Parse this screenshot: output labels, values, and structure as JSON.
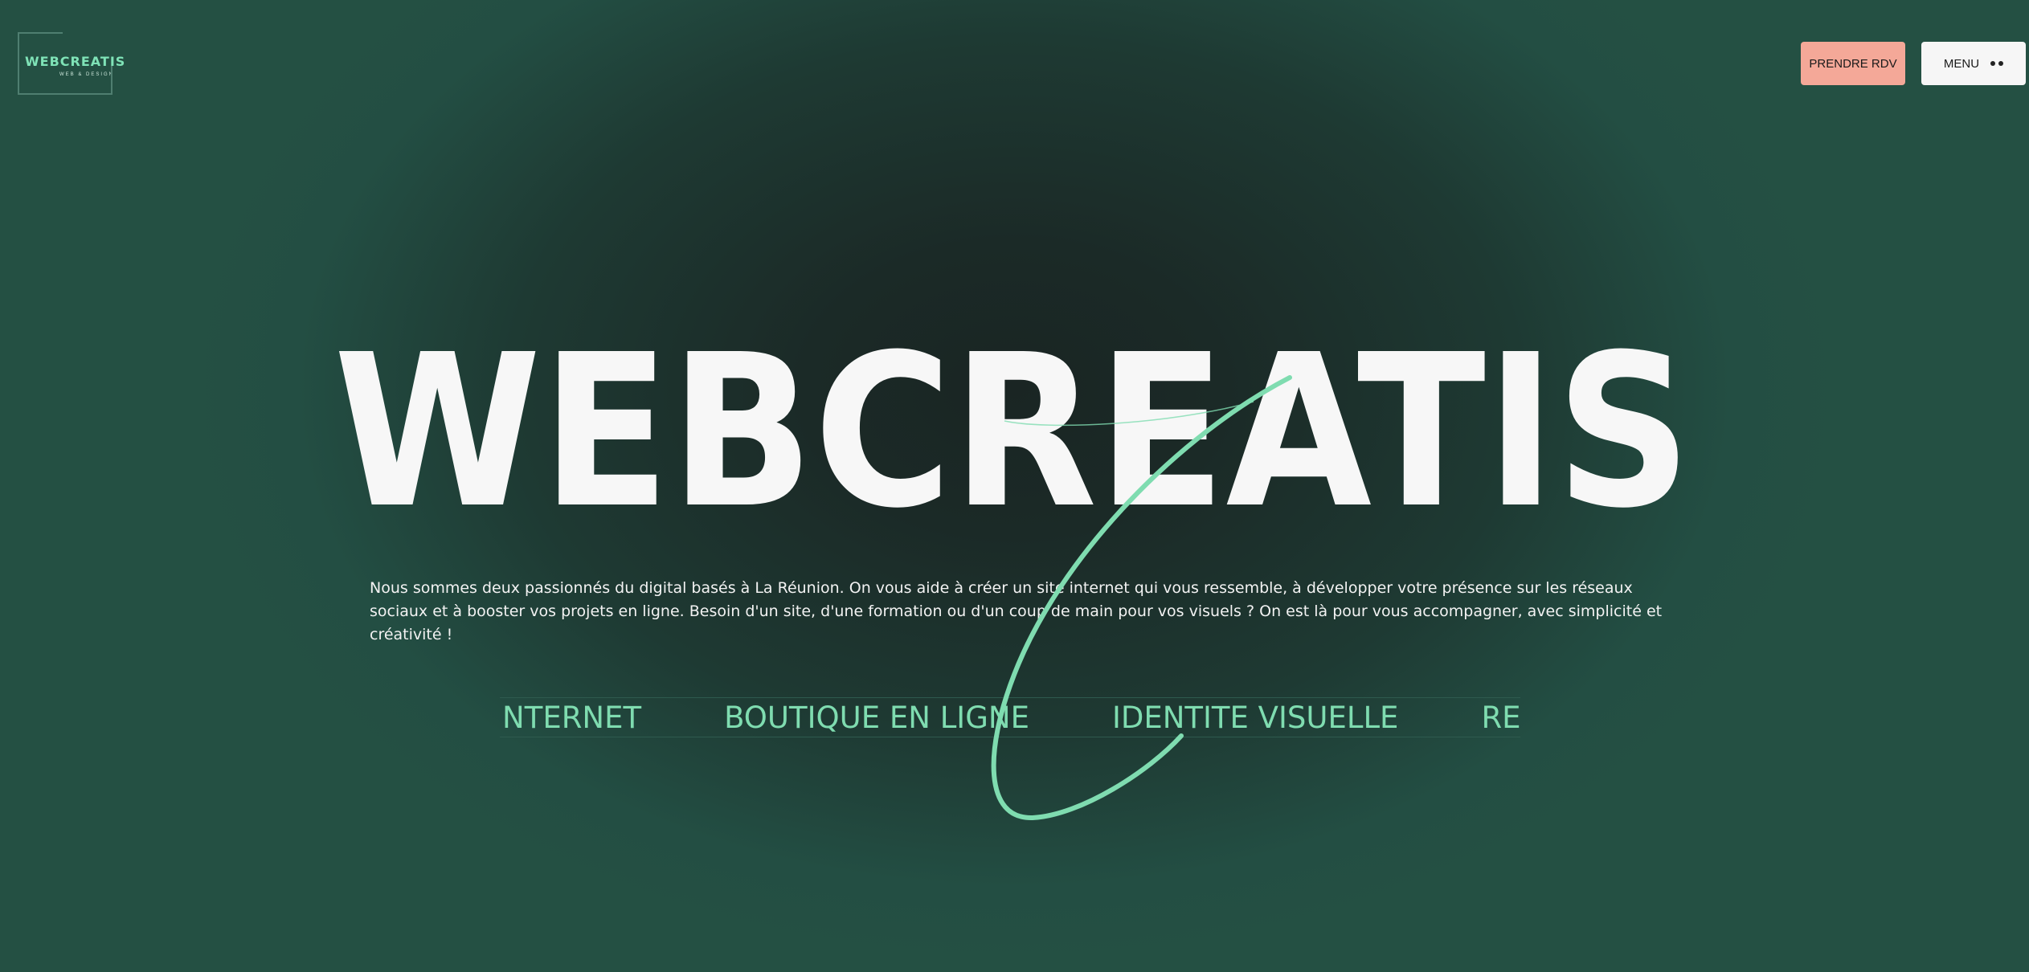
{
  "header": {
    "logo": {
      "title": "WEBCREATIS",
      "subtitle": "WEB & DESIGN"
    },
    "rdv_label": "PRENDRE RDV",
    "menu_label": "MENU"
  },
  "hero": {
    "title": "WEBCREATIS",
    "description": "Nous sommes deux passionnés du digital basés à La Réunion. On vous aide à créer un site internet qui vous ressemble, à développer votre présence sur les réseaux sociaux et à booster vos projets en ligne. Besoin d'un site, d'une formation ou d'un coup de main pour vos visuels ? On est là pour vous accompagner, avec simplicité et créativité !"
  },
  "services": [
    "SITE INTERNET",
    "BOUTIQUE EN LIGNE",
    "IDENTITE VISUELLE",
    "REFONTE & SEO"
  ],
  "colors": {
    "accent": "#7fdcb0",
    "rdv_button": "#f4a898",
    "menu_button": "#f6f6f6",
    "background_center": "#1a2523",
    "background_edge": "#245043"
  },
  "icons": {
    "menu": "two-dots-icon",
    "decoration": "swoosh-curve"
  }
}
